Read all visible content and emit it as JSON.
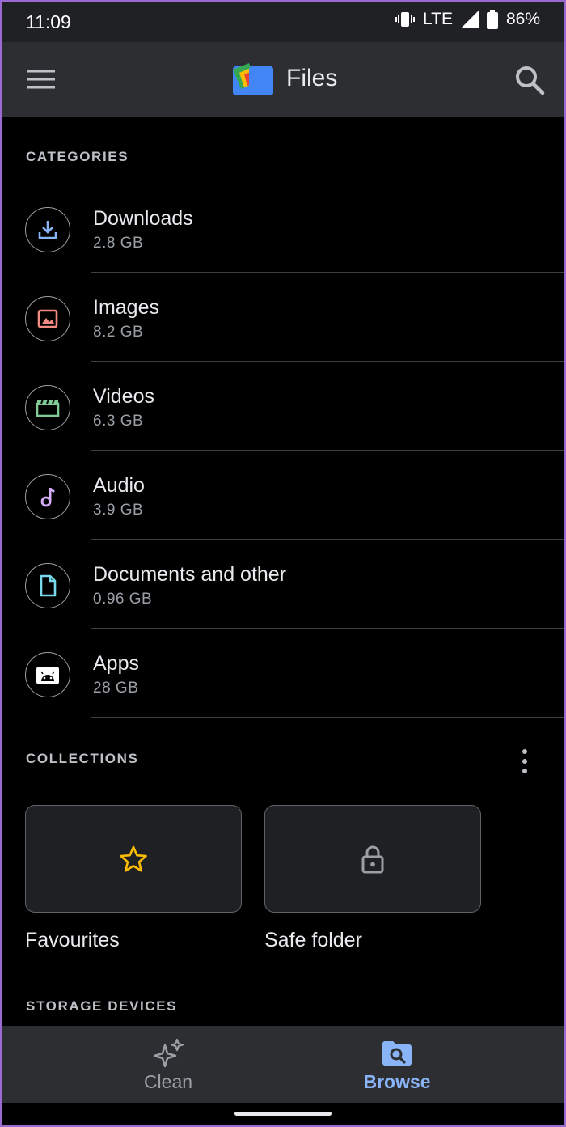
{
  "status_bar": {
    "time": "11:09",
    "network": "LTE",
    "battery": "86%"
  },
  "app_bar": {
    "title": "Files",
    "icons": [
      "menu-icon",
      "files-logo",
      "search-icon"
    ]
  },
  "categories": {
    "label": "CATEGORIES",
    "items": [
      {
        "name": "Downloads",
        "size": "2.8 GB",
        "icon": "download-icon",
        "color": "#8ab4f8"
      },
      {
        "name": "Images",
        "size": "8.2 GB",
        "icon": "image-icon",
        "color": "#f28b82"
      },
      {
        "name": "Videos",
        "size": "6.3 GB",
        "icon": "video-icon",
        "color": "#81c995"
      },
      {
        "name": "Audio",
        "size": "3.9 GB",
        "icon": "music-note-icon",
        "color": "#d7aefb"
      },
      {
        "name": "Documents and other",
        "size": "0.96 GB",
        "icon": "document-icon",
        "color": "#78d9ec"
      },
      {
        "name": "Apps",
        "size": "28 GB",
        "icon": "android-icon",
        "color": "#ffffff"
      }
    ]
  },
  "collections": {
    "label": "COLLECTIONS",
    "items": [
      {
        "name": "Favourites",
        "icon": "star-icon",
        "color": "#fbbc04"
      },
      {
        "name": "Safe folder",
        "icon": "lock-icon",
        "color": "#9aa0a6"
      }
    ]
  },
  "storage_devices": {
    "label": "STORAGE DEVICES"
  },
  "bottom_nav": {
    "items": [
      {
        "label": "Clean",
        "icon": "sparkle-icon",
        "active": false,
        "color": "#9aa0a6"
      },
      {
        "label": "Browse",
        "icon": "browse-folder-icon",
        "active": true,
        "color": "#8ab4f8"
      }
    ]
  }
}
